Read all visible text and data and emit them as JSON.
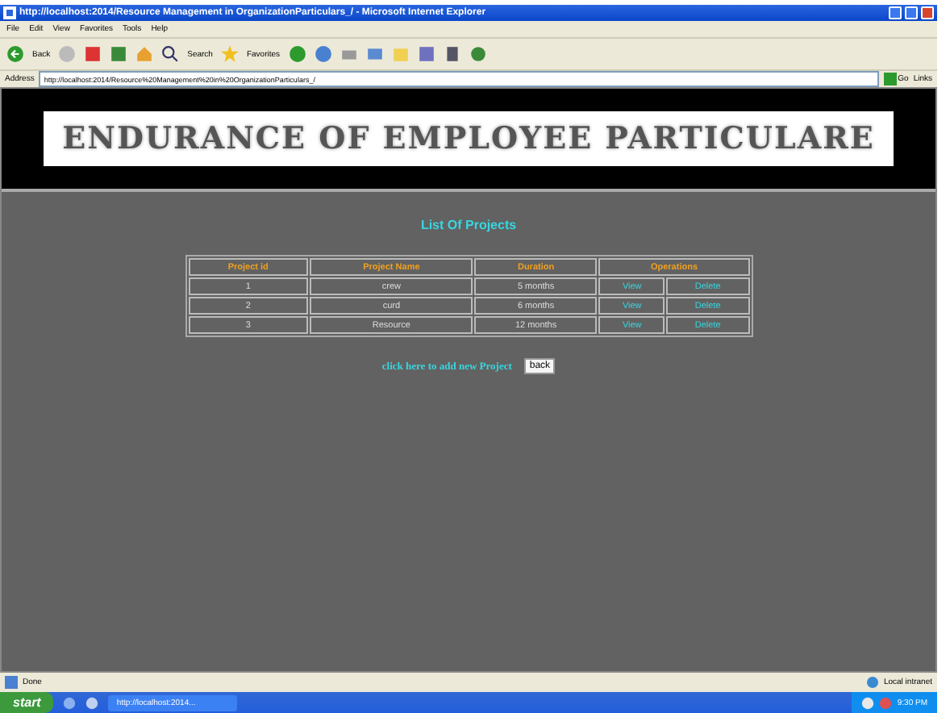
{
  "window": {
    "title": "http://localhost:2014/Resource Management in OrganizationParticulars_/ - Microsoft Internet Explorer"
  },
  "menu": [
    "File",
    "Edit",
    "View",
    "Favorites",
    "Tools",
    "Help"
  ],
  "toolbar": {
    "back": "Back",
    "search": "Search",
    "favorites": "Favorites"
  },
  "address": {
    "label": "Address",
    "value": "http://localhost:2014/Resource%20Management%20in%20OrganizationParticulars_/",
    "go": "Go",
    "links": "Links"
  },
  "banner": {
    "title": "ENDURANCE OF EMPLOYEE PARTICULARE"
  },
  "page": {
    "heading": "List Of Projects",
    "columns": [
      "Project id",
      "Project Name",
      "Duration",
      "Operations"
    ],
    "rows": [
      {
        "id": "1",
        "name": "crew",
        "duration": "5 months",
        "view": "View",
        "delete": "Delete"
      },
      {
        "id": "2",
        "name": "curd",
        "duration": "6 months",
        "view": "View",
        "delete": "Delete"
      },
      {
        "id": "3",
        "name": "Resource",
        "duration": "12 months",
        "view": "View",
        "delete": "Delete"
      }
    ],
    "add_link": "click here to add new Project",
    "back_button": "back"
  },
  "status_bar": {
    "text": "Done",
    "zone": "Local intranet"
  },
  "taskbar": {
    "start": "start",
    "task": "http://localhost:2014...",
    "clock": "9:30 PM"
  }
}
